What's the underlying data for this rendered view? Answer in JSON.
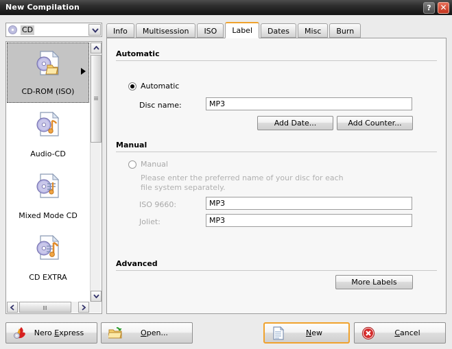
{
  "window": {
    "title": "New Compilation",
    "help_button": "?",
    "close_button": "✕"
  },
  "device_selector": {
    "value": "CD",
    "icon": "disc-icon"
  },
  "compilation_types": [
    {
      "label": "CD-ROM (ISO)",
      "selected": true
    },
    {
      "label": "Audio-CD",
      "selected": false
    },
    {
      "label": "Mixed Mode CD",
      "selected": false
    },
    {
      "label": "CD EXTRA",
      "selected": false
    }
  ],
  "tabs": [
    {
      "label": "Info",
      "active": false
    },
    {
      "label": "Multisession",
      "active": false
    },
    {
      "label": "ISO",
      "active": false
    },
    {
      "label": "Label",
      "active": true
    },
    {
      "label": "Dates",
      "active": false
    },
    {
      "label": "Misc",
      "active": false
    },
    {
      "label": "Burn",
      "active": false
    }
  ],
  "automatic_section": {
    "heading": "Automatic",
    "radio_label": "Automatic",
    "radio_checked": true,
    "disc_name_label": "Disc name:",
    "disc_name_value": "MP3",
    "add_date_button": "Add Date...",
    "add_counter_button": "Add Counter..."
  },
  "manual_section": {
    "heading": "Manual",
    "radio_label": "Manual",
    "radio_checked": false,
    "hint": "Please enter the preferred name of your disc for each file system separately.",
    "iso_label": "ISO 9660:",
    "iso_value": "MP3",
    "joliet_label": "Joliet:",
    "joliet_value": "MP3"
  },
  "advanced_section": {
    "heading": "Advanced",
    "more_labels_button": "More Labels"
  },
  "footer": {
    "nero_express": "Nero Express",
    "nero_express_accel": "E",
    "open": "Open...",
    "open_accel": "O",
    "new": "New",
    "new_accel": "N",
    "cancel": "Cancel",
    "cancel_accel": "C"
  },
  "colors": {
    "accent_orange": "#f0a22c",
    "close_red": "#c3341d",
    "titlebar": "#2e2e2e",
    "panel_bg": "#f7f7f7",
    "selection_gray": "#c4c4c4"
  }
}
